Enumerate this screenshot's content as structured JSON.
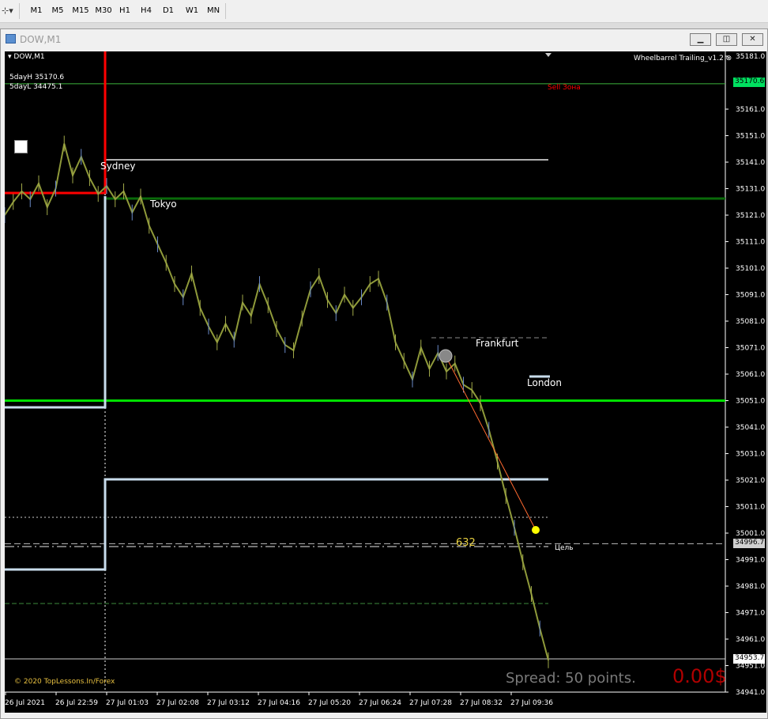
{
  "toolbar": {
    "timeframes": [
      "M1",
      "M5",
      "M15",
      "M30",
      "H1",
      "H4",
      "D1",
      "W1",
      "MN"
    ]
  },
  "window": {
    "title": "DOW,M1",
    "buttons": [
      "minimize-icon",
      "restore-icon",
      "close-icon"
    ]
  },
  "chart": {
    "symbol_label": "DOW,M1",
    "indicator_name": "Wheelbarrel Trailing_v1.2",
    "day_high_label": "5dayH 35170.6",
    "day_low_label": "5dayL 34475.1",
    "sell_zone": "Sell Зона",
    "sessions": [
      "Sydney",
      "Tokyo",
      "Frankfurt",
      "London"
    ],
    "fib_label": "632",
    "target_label": "Цель",
    "copyright": "© 2020 TopLessons.In/Forex",
    "spread": "Spread: 50 points.",
    "profit": "0.00$",
    "price_tags": {
      "high": "35170.6",
      "target": "34996.7",
      "current": "34953.7"
    },
    "colors": {
      "background": "#000000",
      "candles": "#8f9a3a",
      "green": "#00e000",
      "red": "#ff0000",
      "support": "#c8dcec",
      "fib_dot": "#ffff00"
    }
  },
  "chart_data": {
    "type": "line",
    "title": "DOW,M1",
    "ylim": [
      34941.0,
      35181.0
    ],
    "y_ticks": [
      "35181.0",
      "35161.0",
      "35151.0",
      "35141.0",
      "35131.0",
      "35121.0",
      "35111.0",
      "35101.0",
      "35091.0",
      "35081.0",
      "35071.0",
      "35061.0",
      "35051.0",
      "35041.0",
      "35031.0",
      "35021.0",
      "35011.0",
      "35001.0",
      "34991.0",
      "34981.0",
      "34971.0",
      "34961.0",
      "34951.0",
      "34941.0"
    ],
    "x_ticks": [
      "26 Jul 2021",
      "26 Jul 22:59",
      "27 Jul 01:03",
      "27 Jul 02:08",
      "27 Jul 03:12",
      "27 Jul 04:16",
      "27 Jul 05:20",
      "27 Jul 06:24",
      "27 Jul 07:28",
      "27 Jul 08:32",
      "27 Jul 09:36"
    ],
    "series": [
      {
        "values": [
          35121,
          35126,
          35130,
          35127,
          35133,
          35124,
          35131,
          35148,
          35136,
          35143,
          35135,
          35129,
          35132,
          35127,
          35130,
          35122,
          35128,
          35117,
          35110,
          35103,
          35095,
          35090,
          35099,
          35086,
          35079,
          35073,
          35080,
          35074,
          35088,
          35083,
          35095,
          35087,
          35078,
          35072,
          35070,
          35082,
          35093,
          35098,
          35089,
          35084,
          35091,
          35086,
          35090,
          35095,
          35097,
          35088,
          35073,
          35066,
          35059,
          35071,
          35063,
          35069,
          35062,
          35065,
          35057,
          35055,
          35050,
          35040,
          35028,
          35015,
          35003,
          34990,
          34978,
          34965,
          34953
        ]
      }
    ],
    "levels": {
      "day_high": 35170.6,
      "day_low": 34475.1,
      "target": 34996.7,
      "current": 34953.7,
      "green_level": 35051.0
    }
  }
}
